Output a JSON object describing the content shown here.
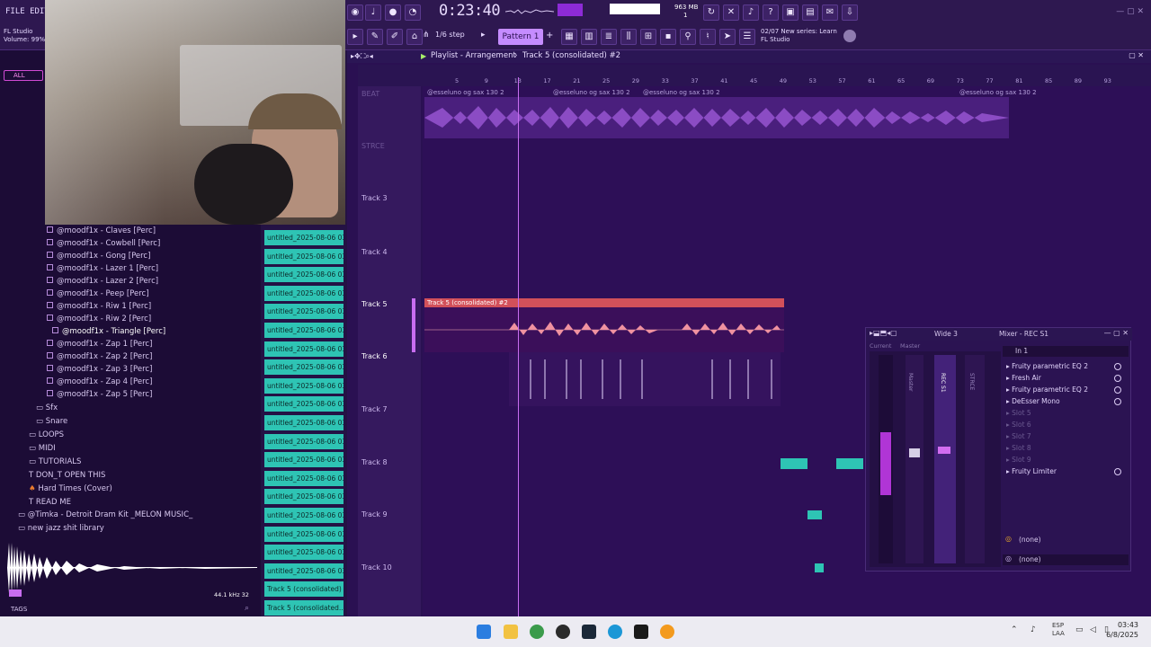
{
  "menu": {
    "file_edit": "FILE EDIT AD",
    "hint_app": "FL Studio",
    "hint_volume": "Volume: 99%"
  },
  "toolbar": {
    "time": "0:23:40",
    "cpu_label": "10",
    "ram_label": "963 MB",
    "ram_sub": "1",
    "step_label": "1/6 step",
    "pattern_label": "Pattern 1",
    "news_date": "02/07",
    "news_text": "New series: Learn",
    "news_app": "FL Studio"
  },
  "playlist": {
    "title": "Playlist - Arrangement",
    "breadcrumb_sep": "›",
    "current_clip": "Track 5 (consolidated) #2",
    "ruler": [
      "5",
      "9",
      "13",
      "17",
      "21",
      "25",
      "29",
      "33",
      "37",
      "41",
      "45",
      "49",
      "53",
      "57",
      "61",
      "65",
      "69",
      "73",
      "77",
      "81",
      "85",
      "89",
      "93"
    ],
    "tracks": [
      "Track 3",
      "Track 4",
      "Track 5",
      "Track 6",
      "Track 7",
      "Track 8",
      "Track 9",
      "Track 10"
    ],
    "clip_top_a": "@esseluno og sax 130 2",
    "clip_top_b": "@esseluno og sax 130 2",
    "clip_top_c": "@esseluno og sax 130 2",
    "clip_top_d": "@esseluno og sax 130 2",
    "clip_track5": "Track 5 (consolidated) #2",
    "track1_name": "BEAT",
    "track2_name": "STRCE"
  },
  "browser": {
    "all_label": "ALL",
    "items": [
      "@moodf1x - Claves [Perc]",
      "@moodf1x - Cowbell [Perc]",
      "@moodf1x - Gong [Perc]",
      "@moodf1x - Lazer 1 [Perc]",
      "@moodf1x - Lazer 2 [Perc]",
      "@moodf1x - Peep [Perc]",
      "@moodf1x - Riw 1 [Perc]",
      "@moodf1x - Riw 2 [Perc]",
      "@moodf1x - Triangle [Perc]",
      "@moodf1x - Zap 1 [Perc]",
      "@moodf1x - Zap 2 [Perc]",
      "@moodf1x - Zap 3 [Perc]",
      "@moodf1x - Zap 4 [Perc]",
      "@moodf1x - Zap 5 [Perc]"
    ],
    "folders": [
      "Sfx",
      "Snare",
      "LOOPS",
      "MIDI",
      "TUTORIALS",
      "DON_T OPEN THIS",
      "Hard Times (Cover)",
      "READ ME"
    ],
    "kit1": "@Timka - Detroit Dram Kit _MELON MUSIC_",
    "kit2": "new jazz shit library",
    "sample_info": "44.1 kHz 32",
    "tags": "TAGS"
  },
  "patterns": {
    "items": [
      "untitled_2025-08-06 03-",
      "untitled_2025-08-06 03-",
      "untitled_2025-08-06 03-",
      "untitled_2025-08-06 03-",
      "untitled_2025-08-06 03-",
      "untitled_2025-08-06 03-",
      "untitled_2025-08-06 03-",
      "untitled_2025-08-06 03-",
      "untitled_2025-08-06 03-",
      "untitled_2025-08-06 03-",
      "untitled_2025-08-06 03-",
      "untitled_2025-08-06 03-",
      "untitled_2025-08-06 03-",
      "untitled_2025-08-06 03-",
      "untitled_2025-08-06 03-",
      "untitled_2025-08-06 03-",
      "untitled_2025-08-06 03-",
      "untitled_2025-08-06 03-",
      "untitled_2025-08-06 03-",
      "Track 5 (consolidated)",
      "Track 5 (consolidated..."
    ]
  },
  "mixer": {
    "title": "Mixer - REC S1",
    "mode": "Wide 3",
    "tab_current": "Current",
    "tab_master": "Master",
    "strip_master": "Master",
    "strip_rec": "REC S1",
    "strip_strce": "STRCE",
    "input": "In 1",
    "slots": [
      {
        "name": "Fruity parametric EQ 2",
        "active": true
      },
      {
        "name": "Fresh Air",
        "active": true
      },
      {
        "name": "Fruity parametric EQ 2",
        "active": true
      },
      {
        "name": "DeEsser Mono",
        "active": true
      },
      {
        "name": "Slot 5",
        "active": false
      },
      {
        "name": "Slot 6",
        "active": false
      },
      {
        "name": "Slot 7",
        "active": false
      },
      {
        "name": "Slot 8",
        "active": false
      },
      {
        "name": "Slot 9",
        "active": false
      },
      {
        "name": "Fruity Limiter",
        "active": true
      }
    ],
    "send_a": "(none)",
    "send_b": "(none)"
  },
  "taskbar": {
    "lang_top": "ESP",
    "lang_bottom": "LAA",
    "time": "03:43",
    "date": "6/8/2025"
  },
  "colors": {
    "accent": "#c86df0",
    "pattern_clip": "#2ec4b4",
    "track5_clip": "#d2505a"
  }
}
